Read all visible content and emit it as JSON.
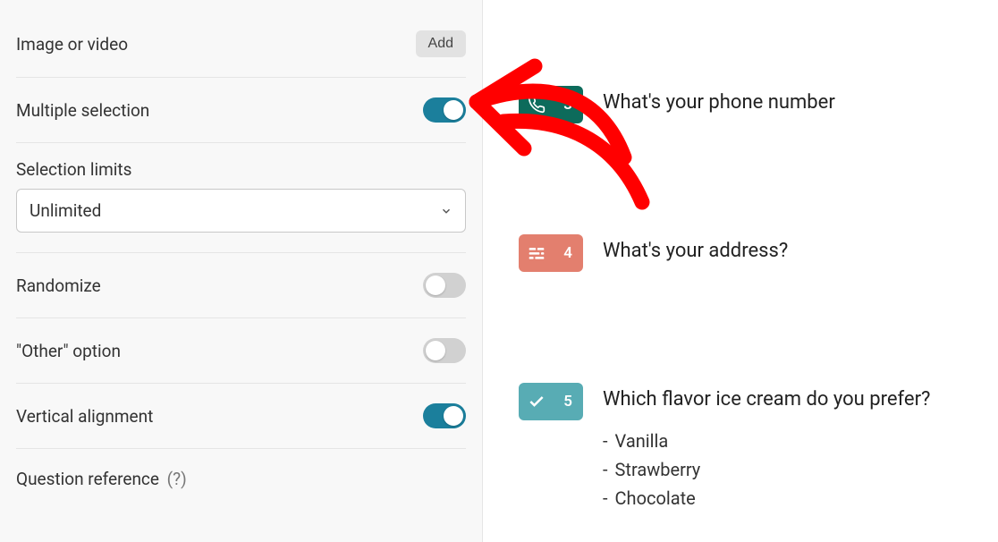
{
  "sidebar": {
    "image_or_video": {
      "label": "Image or video",
      "button": "Add"
    },
    "multiple_selection": {
      "label": "Multiple selection",
      "on": true
    },
    "selection_limits": {
      "label": "Selection limits",
      "value": "Unlimited"
    },
    "randomize": {
      "label": "Randomize",
      "on": false
    },
    "other_option": {
      "label": "\"Other\" option",
      "on": false
    },
    "vertical_alignment": {
      "label": "Vertical alignment",
      "on": true
    },
    "question_reference": {
      "label": "Question reference",
      "help": "(?)"
    }
  },
  "questions": [
    {
      "number": "3",
      "type": "phone",
      "color": "teal-dark",
      "title": "What's your phone number"
    },
    {
      "number": "4",
      "type": "address",
      "color": "coral",
      "title": "What's your address?"
    },
    {
      "number": "5",
      "type": "multiple-choice",
      "color": "teal-light",
      "title": "Which flavor ice cream do you prefer?",
      "options": [
        "Vanilla",
        "Strawberry",
        "Chocolate"
      ]
    }
  ]
}
